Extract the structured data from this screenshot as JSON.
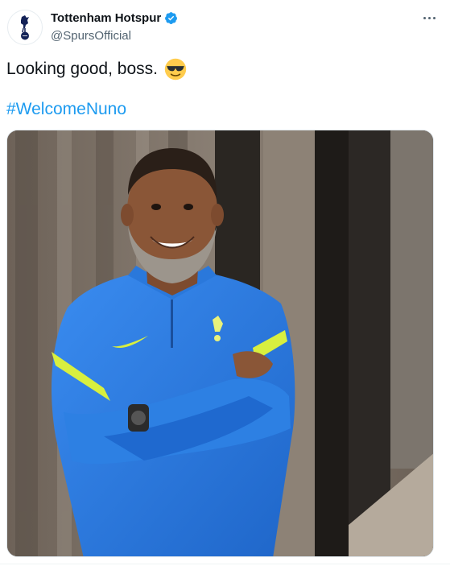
{
  "author": {
    "display_name": "Tottenham Hotspur",
    "handle": "@SpursOfficial",
    "verified": true,
    "avatar_icon": "spurs-cockerel-logo",
    "verified_icon": "verified-badge-icon"
  },
  "tweet": {
    "text": "Looking good, boss.",
    "emoji": "smiling-face-with-sunglasses",
    "hashtag": "#WelcomeNuno"
  },
  "media": {
    "type": "photo"
  },
  "colors": {
    "accent": "#1d9bf0",
    "text": "#0f1419",
    "secondary": "#536471",
    "jacket": "#2f7fe0",
    "jacket_stripe": "#d8ef3f"
  }
}
